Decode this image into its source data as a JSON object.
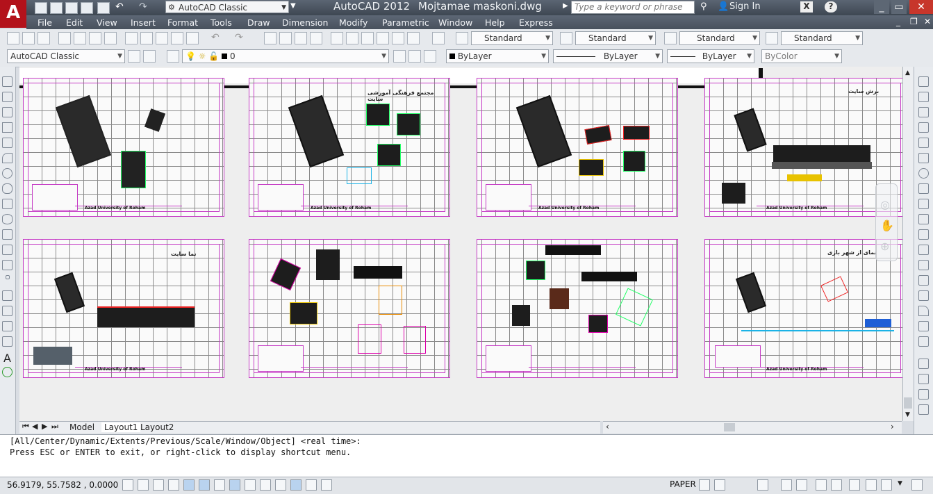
{
  "titlebar": {
    "app_title": "AutoCAD 2012",
    "file_title": "Mojtamae maskoni.dwg",
    "workspace": "AutoCAD Classic",
    "search_placeholder": "Type a keyword or phrase",
    "sign_in": "Sign In",
    "logo": "A"
  },
  "menu": [
    "File",
    "Edit",
    "View",
    "Insert",
    "Format",
    "Tools",
    "Draw",
    "Dimension",
    "Modify",
    "Parametric",
    "Window",
    "Help",
    "Express"
  ],
  "styles_toolbar": {
    "text_style": "Standard",
    "dim_style": "Standard",
    "table_style": "Standard",
    "mleader_style": "Standard"
  },
  "layers_toolbar": {
    "workspace": "AutoCAD Classic",
    "layer": "0",
    "color": "ByLayer",
    "linetype": "ByLayer",
    "lineweight": "ByLayer",
    "plotstyle": "ByColor"
  },
  "sheets": [
    {
      "caption": "Azad University of Roham",
      "heading": ""
    },
    {
      "caption": "Azad University of Roham",
      "heading": "مجتمع فرهنگی آموزشی سایت"
    },
    {
      "caption": "Azad University of Roham",
      "heading": ""
    },
    {
      "caption": "Azad University of Roham",
      "heading": "برش سایت"
    },
    {
      "caption": "Azad University of Roham",
      "heading": "نما سایت"
    },
    {
      "caption": "",
      "heading": ""
    },
    {
      "caption": "",
      "heading": ""
    },
    {
      "caption": "Azad University of Roham",
      "heading": "نمای از شهر بازی"
    }
  ],
  "layout_tabs": [
    "Model",
    "Layout1",
    "Layout2"
  ],
  "command_line": {
    "line1": "[All/Center/Dynamic/Extents/Previous/Scale/Window/Object] <real time>:",
    "line2": "Press ESC or ENTER to exit, or right-click to display shortcut menu."
  },
  "status": {
    "coords": "56.9179, 55.7582 , 0.0000",
    "space": "PAPER"
  },
  "colors": {
    "title_bg": "#4a535f",
    "canvas_bg": "#eeeeee",
    "sheet_border": "#c53ac5",
    "logo_red": "#b3121b"
  }
}
